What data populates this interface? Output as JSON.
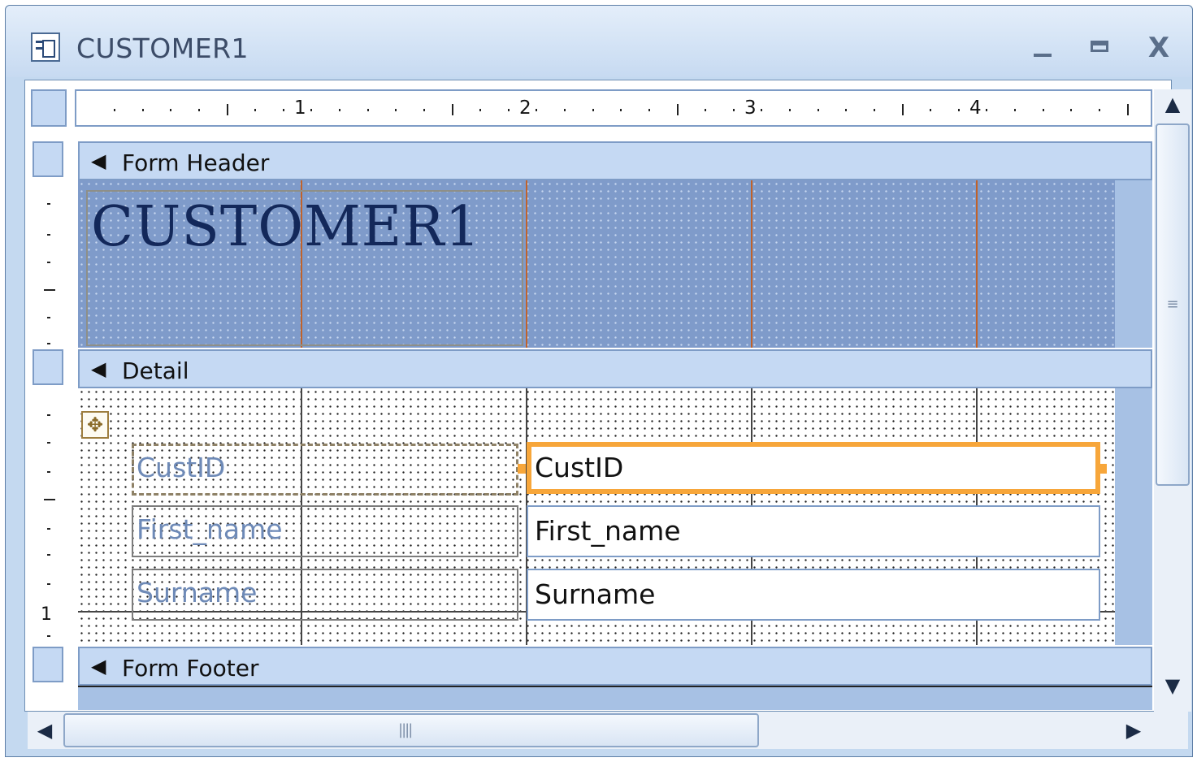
{
  "window": {
    "title": "CUSTOMER1",
    "icon": "form-icon",
    "controls": {
      "minimize": "minimize-icon",
      "maximize": "maximize-icon",
      "close_label": "X"
    }
  },
  "ruler": {
    "numbers": [
      "1",
      "2",
      "3",
      "4"
    ],
    "vertical_number": "1"
  },
  "sections": {
    "header": {
      "label": "Form Header",
      "title_label": "CUSTOMER1"
    },
    "detail": {
      "label": "Detail"
    },
    "footer": {
      "label": "Form Footer"
    }
  },
  "fields": [
    {
      "label": "CustID",
      "control": "CustID",
      "selected": true
    },
    {
      "label": "First_name",
      "control": "First_name",
      "selected": false
    },
    {
      "label": "Surname",
      "control": "Surname",
      "selected": false
    }
  ],
  "colors": {
    "header_fill": "#7f9bca",
    "section_bar": "#c5d9f3",
    "selection": "#f7a63a",
    "label_text": "#6e8ab7",
    "title_text": "#13285a"
  }
}
